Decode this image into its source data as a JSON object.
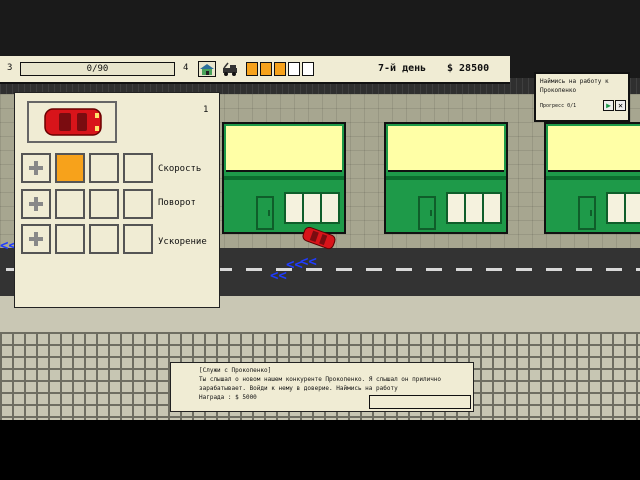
{
  "hud": {
    "level_current": "3",
    "xp_progress": "0/90",
    "xp_fraction": 0.0,
    "level_next": "4",
    "icons": [
      "house-icon",
      "tow-truck-icon"
    ],
    "fuel_slots": [
      true,
      true,
      true,
      false,
      false
    ],
    "day": "7-й день",
    "money": "$ 28500"
  },
  "quest": {
    "text": "Наймись на работу к Прокопенко",
    "progress": "Прогресс 0/1",
    "play_icon": "play-icon",
    "close_icon": "close-icon"
  },
  "upgrades": {
    "car_count": "1",
    "rows": [
      {
        "label": "Скорость",
        "level": 1,
        "max": 3
      },
      {
        "label": "Поворот",
        "level": 0,
        "max": 3
      },
      {
        "label": "Ускорение",
        "level": 0,
        "max": 3
      }
    ]
  },
  "dialog": {
    "text": "[Служи с Прокопенко]\nТы слышал о новом нашем конкуренте Прокопенко. Я слышал он прилично\nзарабатывает. Войди к нему в доверие. Наймись на работу\nНаграда : $ 5000"
  },
  "colors": {
    "accent": "#f7a21b",
    "panel": "#f0ecd4",
    "building": "#1e9a49",
    "sign": "#ffffa6",
    "arrow": "#1f3cff"
  }
}
